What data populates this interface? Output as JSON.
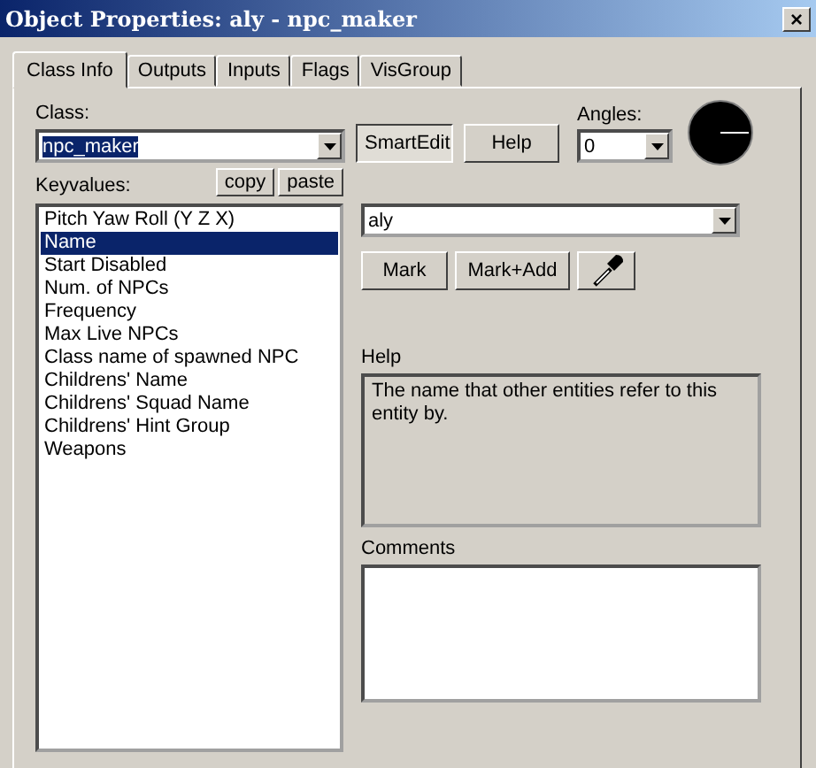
{
  "window": {
    "title": "Object Properties: aly - npc_maker",
    "close": "×"
  },
  "tabs": [
    {
      "label": "Class Info",
      "selected": true
    },
    {
      "label": "Outputs",
      "selected": false
    },
    {
      "label": "Inputs",
      "selected": false
    },
    {
      "label": "Flags",
      "selected": false
    },
    {
      "label": "VisGroup",
      "selected": false
    }
  ],
  "class_label": "Class:",
  "class_value": "npc_maker",
  "smartedit": {
    "label": "SmartEdit",
    "pressed": true
  },
  "help_button": "Help",
  "angles_label": "Angles:",
  "angles_value": "0",
  "keyvalues_label": "Keyvalues:",
  "copy_button": "copy",
  "paste_button": "paste",
  "keyvalues": [
    {
      "label": "Pitch Yaw Roll (Y Z X)",
      "selected": false
    },
    {
      "label": "Name",
      "selected": true
    },
    {
      "label": "Start Disabled",
      "selected": false
    },
    {
      "label": "Num. of NPCs",
      "selected": false
    },
    {
      "label": "Frequency",
      "selected": false
    },
    {
      "label": "Max Live NPCs",
      "selected": false
    },
    {
      "label": "Class name of spawned NPC",
      "selected": false
    },
    {
      "label": "Childrens' Name",
      "selected": false
    },
    {
      "label": "Childrens' Squad Name",
      "selected": false
    },
    {
      "label": "Childrens' Hint Group",
      "selected": false
    },
    {
      "label": "Weapons",
      "selected": false
    }
  ],
  "value": "aly",
  "mark_button": "Mark",
  "mark_add_button": "Mark+Add",
  "help_label": "Help",
  "help_text": "The name that other entities refer to this entity by.",
  "comments_label": "Comments"
}
